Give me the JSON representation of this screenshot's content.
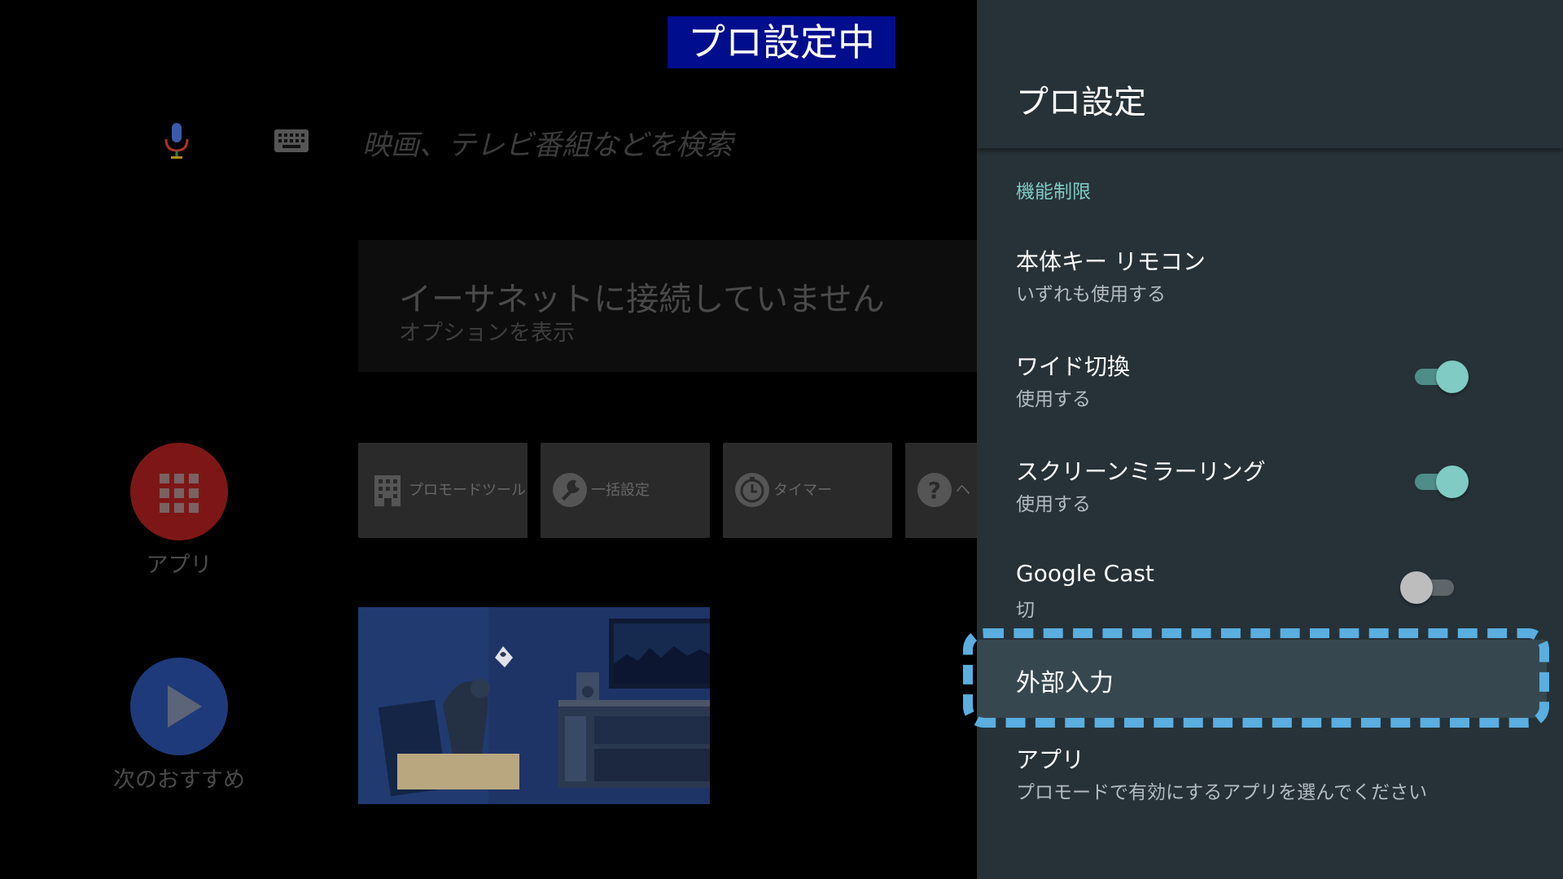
{
  "banner": {
    "text": "プロ設定中",
    "bg_color": "#000d8c"
  },
  "home": {
    "search": {
      "mic_icon": "microphone-icon",
      "keyboard_icon": "keyboard-icon",
      "hint": "映画、テレビ番組などを検索"
    },
    "network_card": {
      "title": "イーサネットに接続していません",
      "subtitle": "オプションを表示"
    },
    "side": {
      "apps_label": "アプリ",
      "apps_icon": "apps-grid-icon",
      "apps_color": "#7d1717",
      "next_label": "次のおすすめ",
      "next_icon": "play-icon",
      "next_color": "#1e3a7a"
    },
    "tiles": [
      {
        "label": "プロモードツール",
        "icon": "building-icon"
      },
      {
        "label": "一括設定",
        "icon": "wrench-icon"
      },
      {
        "label": "タイマー",
        "icon": "timer-icon"
      },
      {
        "label": "ヘ",
        "icon": "help-icon"
      }
    ]
  },
  "panel": {
    "title": "プロ設定",
    "section_label": "機能制限",
    "accent_color": "#80cbc4",
    "items": [
      {
        "title": "本体キー リモコン",
        "subtitle": "いずれも使用する"
      },
      {
        "title": "ワイド切換",
        "subtitle": "使用する",
        "toggle": "on"
      },
      {
        "title": "スクリーンミラーリング",
        "subtitle": "使用する",
        "toggle": "on"
      },
      {
        "title": "Google Cast",
        "subtitle": "切",
        "toggle": "off"
      }
    ],
    "focused_item": {
      "title": "外部入力"
    },
    "last_item": {
      "title": "アプリ",
      "subtitle": "プロモードで有効にするアプリを選んでください"
    }
  }
}
